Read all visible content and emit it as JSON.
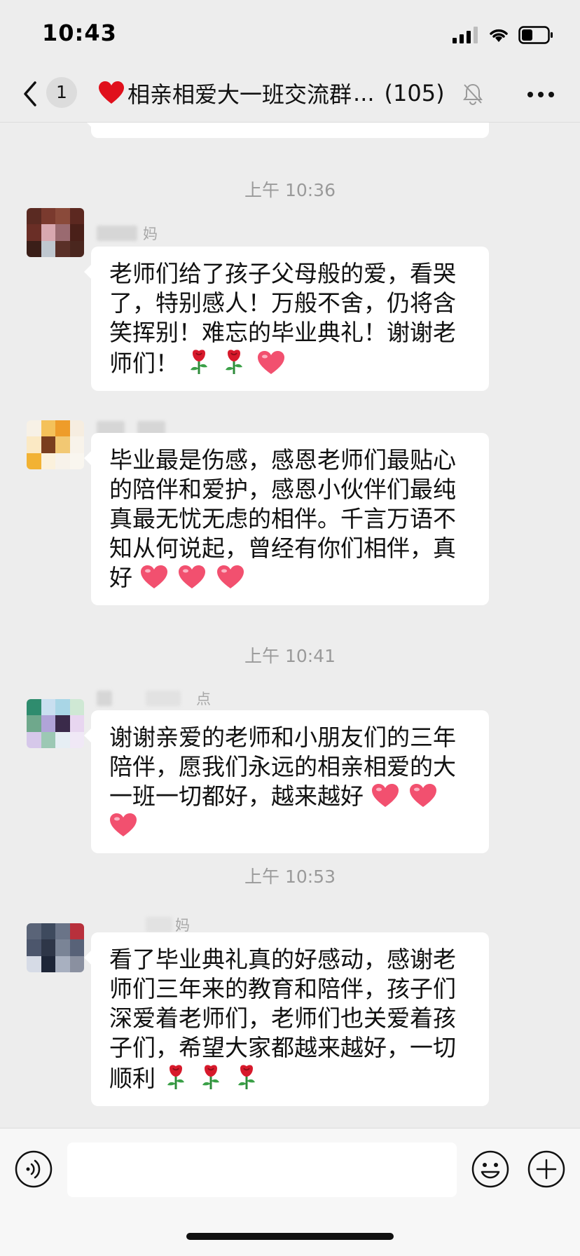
{
  "status_bar": {
    "time": "10:43"
  },
  "nav": {
    "unread_count": "1",
    "title": "相亲相爱大一班交流群",
    "ellipsis": "...",
    "member_count": "(105)"
  },
  "messages": [
    {
      "timestamp": "上午 10:36",
      "nickname_suffix": "妈",
      "text": "老师们给了孩子父母般的爱，看哭了，特别感人！万般不舍，仍将含笑挥别！难忘的毕业典礼！谢谢老师们！",
      "emojis": [
        "rose-icon",
        "rose-icon",
        "heart-icon"
      ]
    },
    {
      "nickname_suffix": "",
      "text": "毕业最是伤感，感恩老师们最贴心的陪伴和爱护，感恩小伙伴们最纯真最无忧无虑的相伴。千言万语不知从何说起，曾经有你们相伴，真好",
      "emojis": [
        "heart-icon",
        "heart-icon",
        "heart-icon"
      ]
    },
    {
      "timestamp": "上午 10:41",
      "nickname_suffix": "点",
      "text": "谢谢亲爱的老师和小朋友们的三年陪伴，愿我们永远的相亲相爱的大一班一切都好，越来越好",
      "emojis": [
        "heart-icon",
        "heart-icon",
        "heart-icon"
      ]
    },
    {
      "timestamp": "上午 10:53",
      "nickname_suffix": "妈",
      "text": "看了毕业典礼真的好感动，感谢老师们三年来的教育和陪伴，孩子们深爱着老师们，老师们也关爱着孩子们，希望大家都越来越好，一切顺利",
      "emojis": [
        "rose-icon",
        "rose-icon",
        "rose-icon"
      ]
    }
  ],
  "input": {
    "placeholder": ""
  },
  "colors": {
    "background": "#ededed",
    "bubble": "#ffffff",
    "heart": "#f2506f",
    "rose": "#d7192b",
    "timestamp": "#9a9a9a"
  }
}
